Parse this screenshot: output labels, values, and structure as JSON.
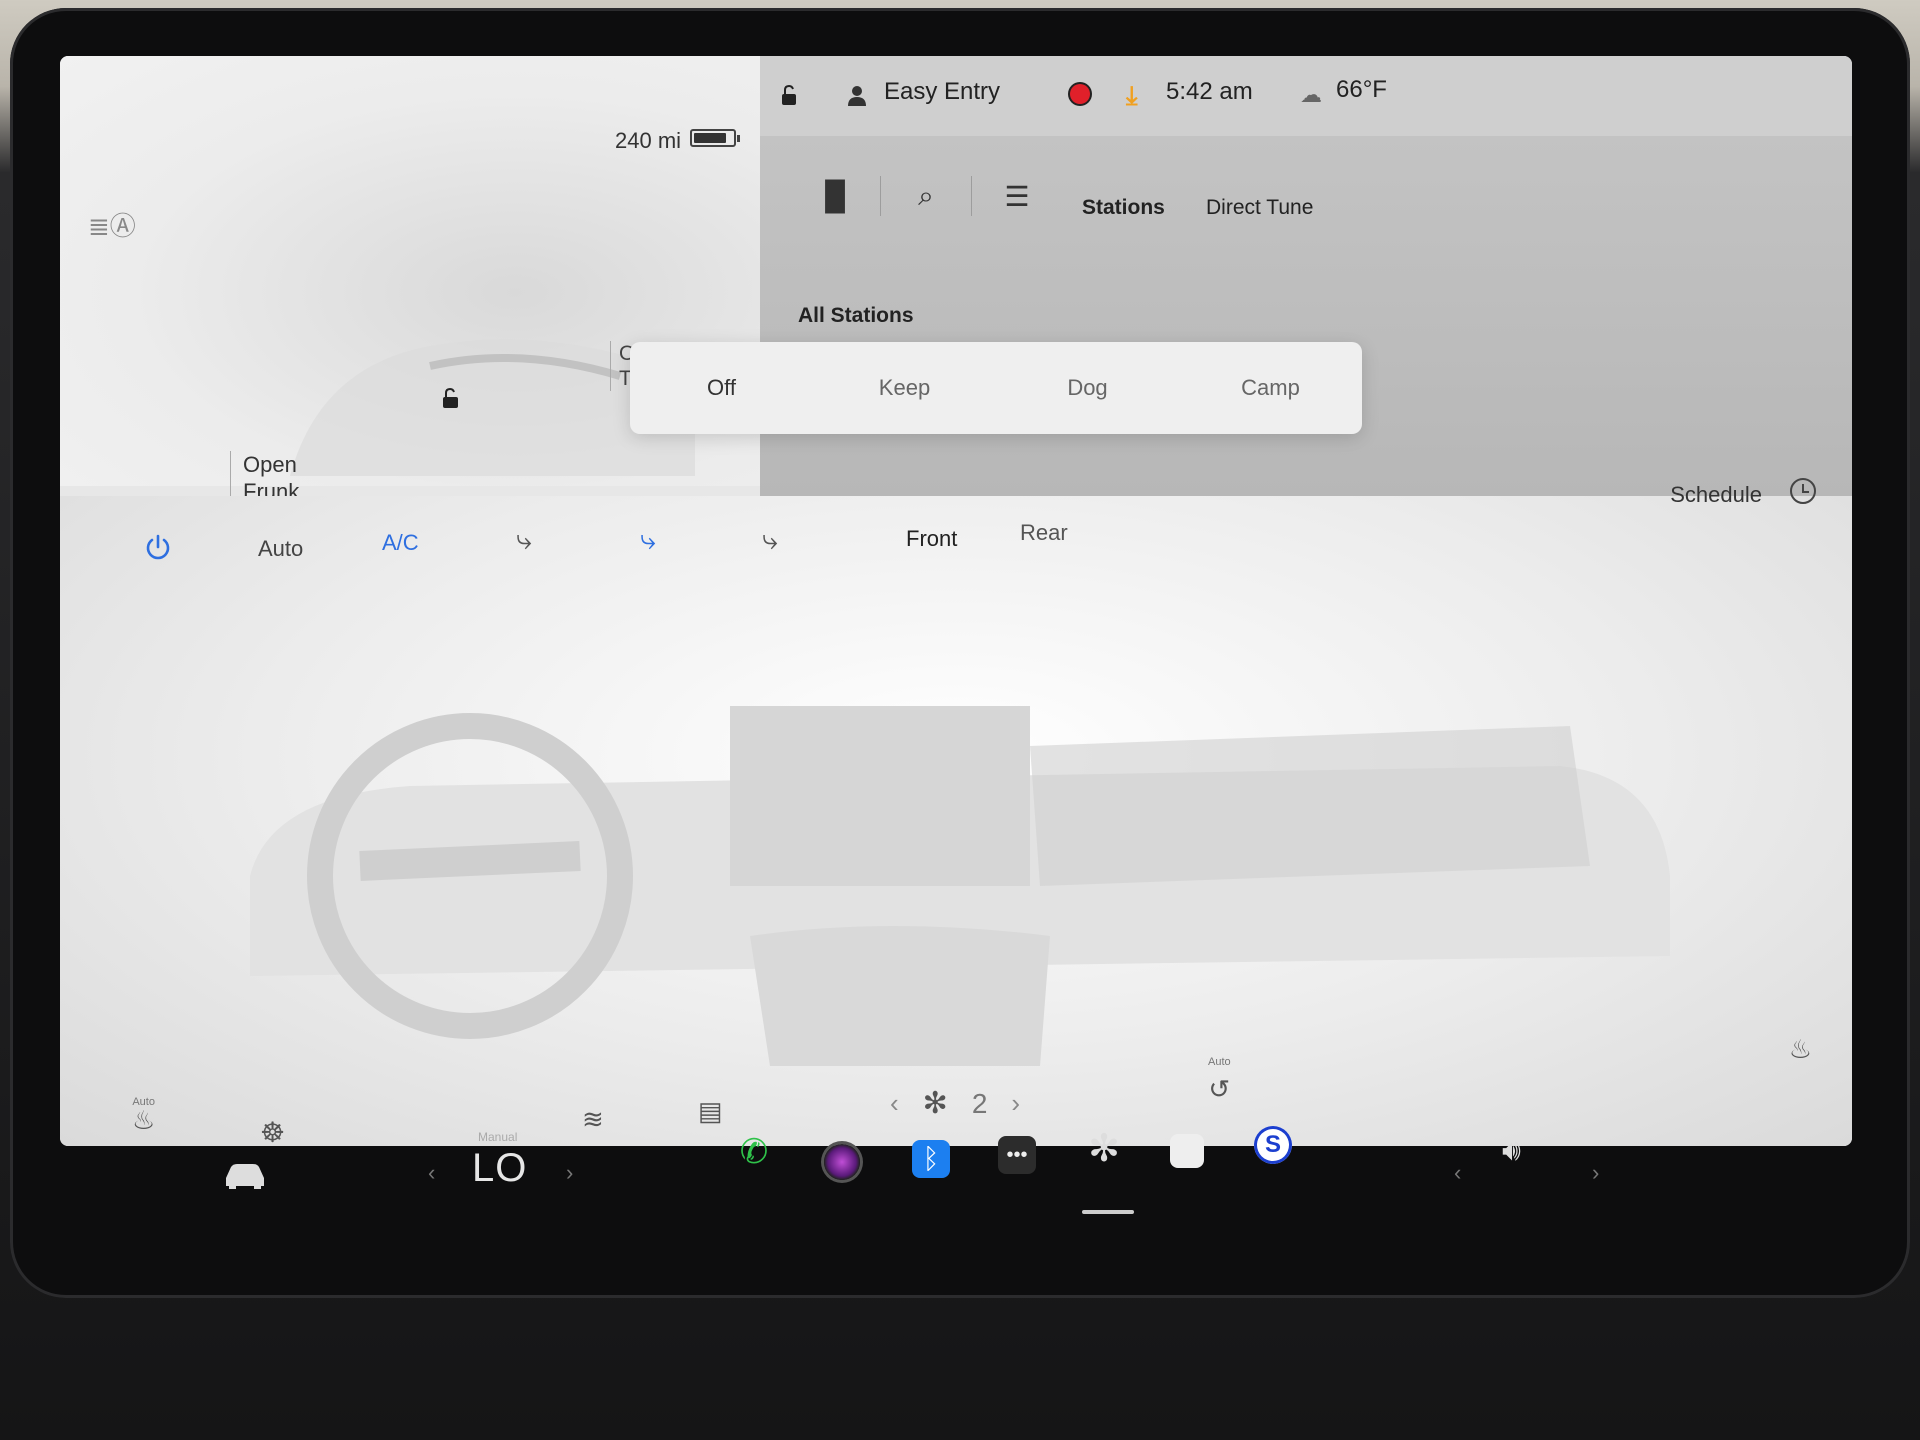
{
  "car": {
    "range": "240 mi",
    "battery_level": 0.85,
    "open_frunk_line1": "Open",
    "open_frunk_line2": "Frunk",
    "open_trunk_line1": "Open",
    "open_trunk_line2": "Trunk"
  },
  "status_bar": {
    "user": "Easy Entry",
    "time": "5:42 am",
    "temperature": "66°F",
    "record_color": "#e0202a",
    "download_color": "#f0a020"
  },
  "media": {
    "tabs": [
      "Stations",
      "Direct Tune"
    ],
    "section_title": "All Stations",
    "icons": [
      "equalizer-icon",
      "search-icon",
      "list-icon"
    ]
  },
  "climate_modes": {
    "options": [
      "Off",
      "Keep",
      "Dog",
      "Camp"
    ],
    "selected": "Off"
  },
  "climate": {
    "schedule_label": "Schedule",
    "auto_label": "Auto",
    "ac_label": "A/C",
    "front_label": "Front",
    "rear_label": "Rear",
    "fan_speed": "2",
    "seat_auto_label": "Auto",
    "recirc_auto_label": "Auto",
    "accent_color": "#2e6fe0"
  },
  "dock": {
    "temp_mode_label": "Manual",
    "temp_value": "LO",
    "apps": [
      "phone-icon",
      "camera-icon",
      "bluetooth-icon",
      "more-icon",
      "fan-icon",
      "manual-icon",
      "siriusxm-icon"
    ],
    "active_app": "fan-icon"
  }
}
